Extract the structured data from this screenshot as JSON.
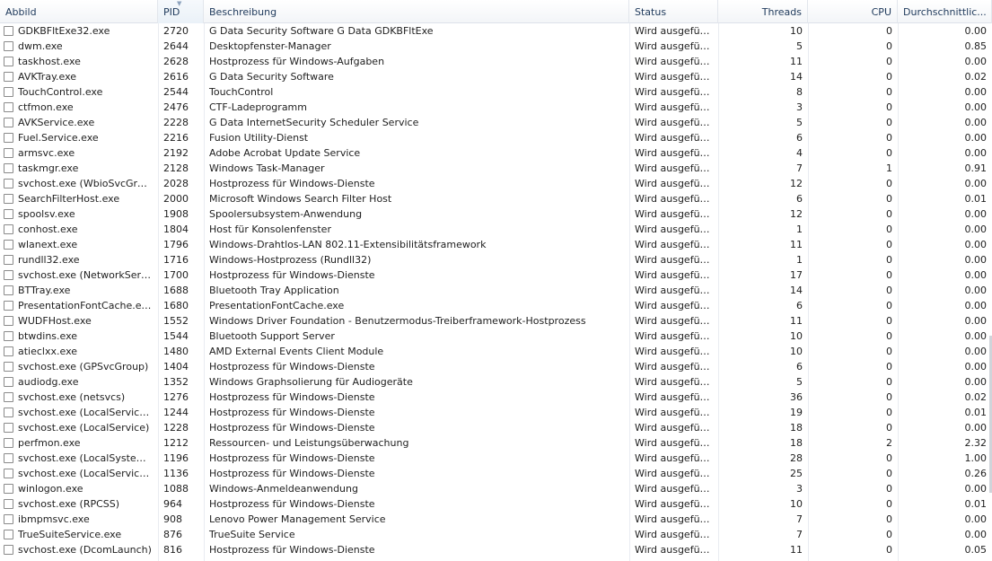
{
  "columns": {
    "name": "Abbild",
    "pid": "PID",
    "desc": "Beschreibung",
    "status": "Status",
    "threads": "Threads",
    "cpu": "CPU",
    "avg": "Durchschnittlic..."
  },
  "rows": [
    {
      "name": "GDKBFltExe32.exe",
      "pid": "2720",
      "desc": "G Data Security Software G Data GDKBFltExe",
      "status": "Wird ausgeführt",
      "threads": "10",
      "cpu": "0",
      "avg": "0.00"
    },
    {
      "name": "dwm.exe",
      "pid": "2644",
      "desc": "Desktopfenster-Manager",
      "status": "Wird ausgeführt",
      "threads": "5",
      "cpu": "0",
      "avg": "0.85"
    },
    {
      "name": "taskhost.exe",
      "pid": "2628",
      "desc": "Hostprozess für Windows-Aufgaben",
      "status": "Wird ausgeführt",
      "threads": "11",
      "cpu": "0",
      "avg": "0.00"
    },
    {
      "name": "AVKTray.exe",
      "pid": "2616",
      "desc": "G Data Security Software",
      "status": "Wird ausgeführt",
      "threads": "14",
      "cpu": "0",
      "avg": "0.02"
    },
    {
      "name": "TouchControl.exe",
      "pid": "2544",
      "desc": "TouchControl",
      "status": "Wird ausgeführt",
      "threads": "8",
      "cpu": "0",
      "avg": "0.00"
    },
    {
      "name": "ctfmon.exe",
      "pid": "2476",
      "desc": "CTF-Ladeprogramm",
      "status": "Wird ausgeführt",
      "threads": "3",
      "cpu": "0",
      "avg": "0.00"
    },
    {
      "name": "AVKService.exe",
      "pid": "2228",
      "desc": "G Data InternetSecurity Scheduler Service",
      "status": "Wird ausgeführt",
      "threads": "5",
      "cpu": "0",
      "avg": "0.00"
    },
    {
      "name": "Fuel.Service.exe",
      "pid": "2216",
      "desc": "Fusion Utility-Dienst",
      "status": "Wird ausgeführt",
      "threads": "6",
      "cpu": "0",
      "avg": "0.00"
    },
    {
      "name": "armsvc.exe",
      "pid": "2192",
      "desc": "Adobe Acrobat Update Service",
      "status": "Wird ausgeführt",
      "threads": "4",
      "cpu": "0",
      "avg": "0.00"
    },
    {
      "name": "taskmgr.exe",
      "pid": "2128",
      "desc": "Windows Task-Manager",
      "status": "Wird ausgeführt",
      "threads": "7",
      "cpu": "1",
      "avg": "0.91"
    },
    {
      "name": "svchost.exe (WbioSvcGroup)",
      "pid": "2028",
      "desc": "Hostprozess für Windows-Dienste",
      "status": "Wird ausgeführt",
      "threads": "12",
      "cpu": "0",
      "avg": "0.00"
    },
    {
      "name": "SearchFilterHost.exe",
      "pid": "2000",
      "desc": "Microsoft Windows Search Filter Host",
      "status": "Wird ausgeführt",
      "threads": "6",
      "cpu": "0",
      "avg": "0.01"
    },
    {
      "name": "spoolsv.exe",
      "pid": "1908",
      "desc": "Spoolersubsystem-Anwendung",
      "status": "Wird ausgeführt",
      "threads": "12",
      "cpu": "0",
      "avg": "0.00"
    },
    {
      "name": "conhost.exe",
      "pid": "1804",
      "desc": "Host für Konsolenfenster",
      "status": "Wird ausgeführt",
      "threads": "1",
      "cpu": "0",
      "avg": "0.00"
    },
    {
      "name": "wlanext.exe",
      "pid": "1796",
      "desc": "Windows-Drahtlos-LAN 802.11-Extensibilitätsframework",
      "status": "Wird ausgeführt",
      "threads": "11",
      "cpu": "0",
      "avg": "0.00"
    },
    {
      "name": "rundll32.exe",
      "pid": "1716",
      "desc": "Windows-Hostprozess (Rundll32)",
      "status": "Wird ausgeführt",
      "threads": "1",
      "cpu": "0",
      "avg": "0.00"
    },
    {
      "name": "svchost.exe (NetworkService)",
      "pid": "1700",
      "desc": "Hostprozess für Windows-Dienste",
      "status": "Wird ausgeführt",
      "threads": "17",
      "cpu": "0",
      "avg": "0.00"
    },
    {
      "name": "BTTray.exe",
      "pid": "1688",
      "desc": "Bluetooth Tray Application",
      "status": "Wird ausgeführt",
      "threads": "14",
      "cpu": "0",
      "avg": "0.00"
    },
    {
      "name": "PresentationFontCache.exe",
      "pid": "1680",
      "desc": "PresentationFontCache.exe",
      "status": "Wird ausgeführt",
      "threads": "6",
      "cpu": "0",
      "avg": "0.00"
    },
    {
      "name": "WUDFHost.exe",
      "pid": "1552",
      "desc": "Windows Driver Foundation - Benutzermodus-Treiberframework-Hostprozess",
      "status": "Wird ausgeführt",
      "threads": "11",
      "cpu": "0",
      "avg": "0.00"
    },
    {
      "name": "btwdins.exe",
      "pid": "1544",
      "desc": "Bluetooth Support Server",
      "status": "Wird ausgeführt",
      "threads": "10",
      "cpu": "0",
      "avg": "0.00"
    },
    {
      "name": "atieclxx.exe",
      "pid": "1480",
      "desc": "AMD External Events Client Module",
      "status": "Wird ausgeführt",
      "threads": "10",
      "cpu": "0",
      "avg": "0.00"
    },
    {
      "name": "svchost.exe (GPSvcGroup)",
      "pid": "1404",
      "desc": "Hostprozess für Windows-Dienste",
      "status": "Wird ausgeführt",
      "threads": "6",
      "cpu": "0",
      "avg": "0.00"
    },
    {
      "name": "audiodg.exe",
      "pid": "1352",
      "desc": "Windows Graphsolierung für Audiogeräte",
      "status": "Wird ausgeführt",
      "threads": "5",
      "cpu": "0",
      "avg": "0.00"
    },
    {
      "name": "svchost.exe (netsvcs)",
      "pid": "1276",
      "desc": "Hostprozess für Windows-Dienste",
      "status": "Wird ausgeführt",
      "threads": "36",
      "cpu": "0",
      "avg": "0.02"
    },
    {
      "name": "svchost.exe (LocalServiceNo...",
      "pid": "1244",
      "desc": "Hostprozess für Windows-Dienste",
      "status": "Wird ausgeführt",
      "threads": "19",
      "cpu": "0",
      "avg": "0.01"
    },
    {
      "name": "svchost.exe (LocalService)",
      "pid": "1228",
      "desc": "Hostprozess für Windows-Dienste",
      "status": "Wird ausgeführt",
      "threads": "18",
      "cpu": "0",
      "avg": "0.00"
    },
    {
      "name": "perfmon.exe",
      "pid": "1212",
      "desc": "Ressourcen- und Leistungsüberwachung",
      "status": "Wird ausgeführt",
      "threads": "18",
      "cpu": "2",
      "avg": "2.32"
    },
    {
      "name": "svchost.exe (LocalSystemNet...",
      "pid": "1196",
      "desc": "Hostprozess für Windows-Dienste",
      "status": "Wird ausgeführt",
      "threads": "28",
      "cpu": "0",
      "avg": "1.00"
    },
    {
      "name": "svchost.exe (LocalServiceNet...",
      "pid": "1136",
      "desc": "Hostprozess für Windows-Dienste",
      "status": "Wird ausgeführt",
      "threads": "25",
      "cpu": "0",
      "avg": "0.26"
    },
    {
      "name": "winlogon.exe",
      "pid": "1088",
      "desc": "Windows-Anmeldeanwendung",
      "status": "Wird ausgeführt",
      "threads": "3",
      "cpu": "0",
      "avg": "0.00"
    },
    {
      "name": "svchost.exe (RPCSS)",
      "pid": "964",
      "desc": "Hostprozess für Windows-Dienste",
      "status": "Wird ausgeführt",
      "threads": "10",
      "cpu": "0",
      "avg": "0.01"
    },
    {
      "name": "ibmpmsvc.exe",
      "pid": "908",
      "desc": "Lenovo Power Management Service",
      "status": "Wird ausgeführt",
      "threads": "7",
      "cpu": "0",
      "avg": "0.00"
    },
    {
      "name": "TrueSuiteService.exe",
      "pid": "876",
      "desc": "TrueSuite Service",
      "status": "Wird ausgeführt",
      "threads": "7",
      "cpu": "0",
      "avg": "0.00"
    },
    {
      "name": "svchost.exe (DcomLaunch)",
      "pid": "816",
      "desc": "Hostprozess für Windows-Dienste",
      "status": "Wird ausgeführt",
      "threads": "11",
      "cpu": "0",
      "avg": "0.05"
    }
  ]
}
